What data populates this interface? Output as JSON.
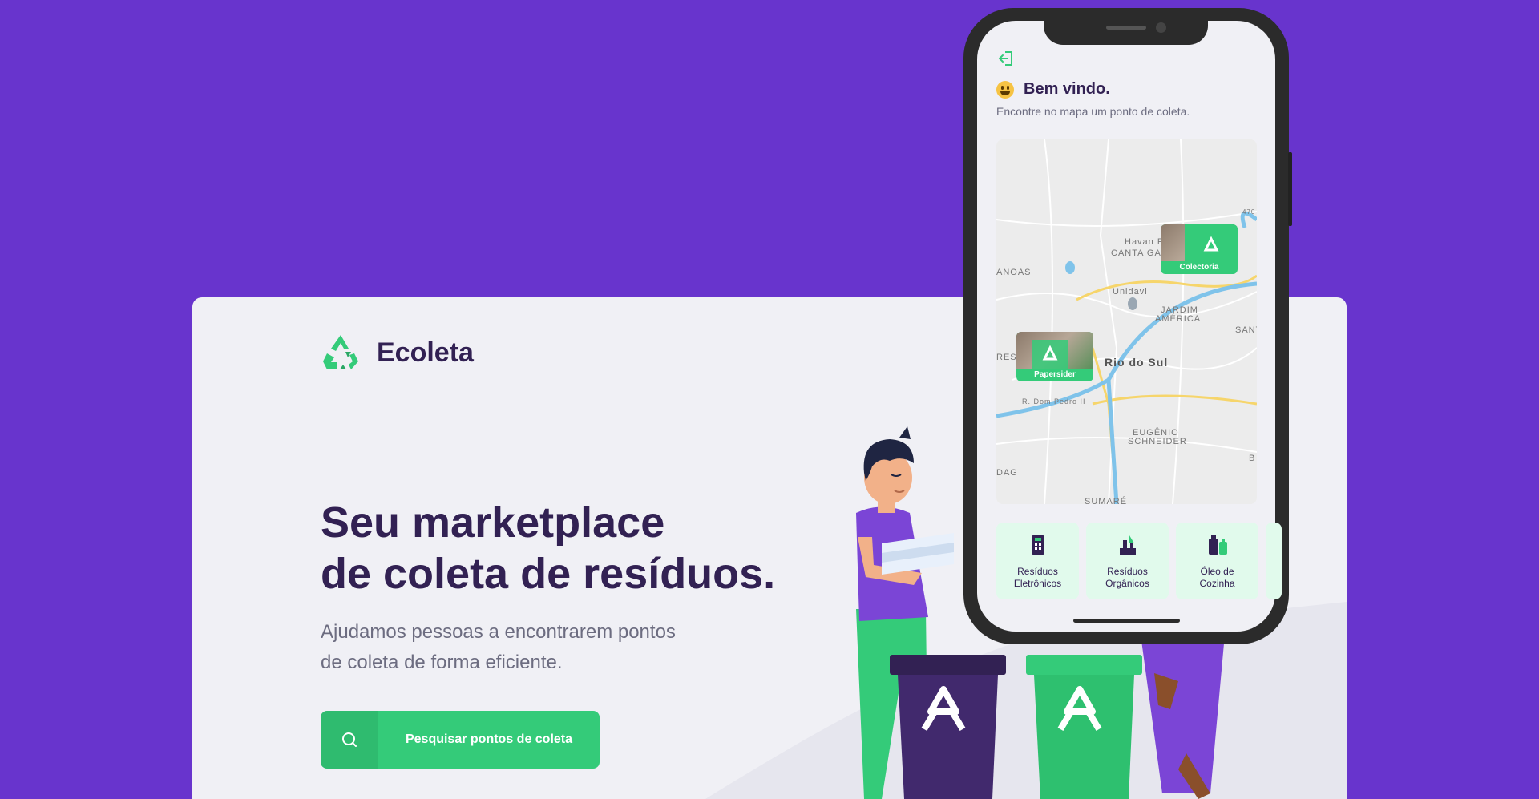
{
  "brand": {
    "name": "Ecoleta"
  },
  "hero": {
    "headline_line1": "Seu marketplace",
    "headline_line2": "de coleta de resíduos.",
    "subtitle_line1": "Ajudamos pessoas a encontrarem pontos",
    "subtitle_line2": "de coleta de forma eficiente.",
    "cta_label": "Pesquisar pontos de coleta"
  },
  "phone": {
    "welcome_title": "Bem vindo.",
    "welcome_subtitle": "Encontre no mapa um ponto de coleta.",
    "map_labels": [
      "Havan Ri",
      "CANTA GA",
      "ANOAS",
      "Unidavi",
      "JARDIM",
      "AMÉRICA",
      "SANT",
      "RESS",
      "Rio do Sul",
      "R. Dom Pedro II",
      "EUGÊNIO",
      "SCHNEIDER",
      "DAG",
      "SUMARÉ",
      "B",
      "470"
    ],
    "markers": [
      {
        "label": "Colectoria"
      },
      {
        "label": "Papersider"
      }
    ],
    "items": [
      {
        "line1": "Resíduos",
        "line2": "Eletrônicos",
        "icon": "battery-icon"
      },
      {
        "line1": "Resíduos",
        "line2": "Orgânicos",
        "icon": "compost-icon"
      },
      {
        "line1": "Óleo de",
        "line2": "Cozinha",
        "icon": "oil-bottle-icon"
      }
    ]
  },
  "colors": {
    "primary": "#34cb79",
    "background": "#6834cd",
    "title": "#322153",
    "text": "#6c6c80"
  }
}
